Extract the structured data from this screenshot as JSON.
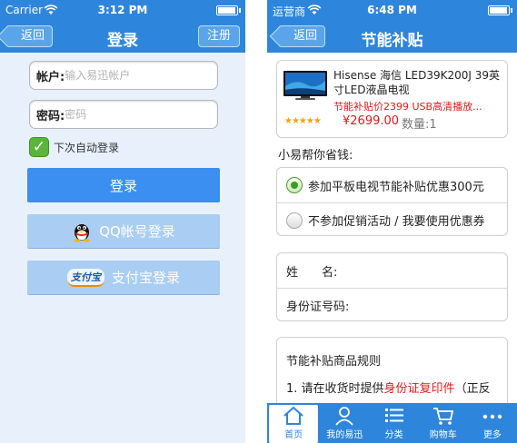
{
  "left": {
    "status": {
      "carrier": "Carrier",
      "time": "3:12 PM",
      "battery_fraction": 0.9
    },
    "nav": {
      "back": "返回",
      "title": "登录",
      "register": "注册"
    },
    "account": {
      "label": "帐户:",
      "placeholder": "输入易迅帐户"
    },
    "password": {
      "label": "密码:",
      "placeholder": "密码"
    },
    "remember": {
      "label": "下次自动登录",
      "checked": true
    },
    "buttons": {
      "login": "登录",
      "qq": "QQ帐号登录",
      "alipay": "支付宝登录",
      "alipay_logo": "支付宝"
    }
  },
  "right": {
    "status": {
      "carrier": "运营商",
      "time": "6:48 PM",
      "battery_fraction": 0.9
    },
    "nav": {
      "back": "返回",
      "title": "节能补贴"
    },
    "product": {
      "title": "Hisense 海信 LED39K200J 39英寸LED液晶电视",
      "promo": "节能补贴价2399 USB高清播放...",
      "rating_stars": 5,
      "price": "¥2699.00",
      "quantity": "数量:1"
    },
    "saving_label": "小易帮你省钱:",
    "options": [
      {
        "label": "参加平板电视节能补贴优惠300元",
        "selected": true
      },
      {
        "label": "不参加促销活动 / 我要使用优惠券",
        "selected": false
      }
    ],
    "form": {
      "name_label": "姓　　名:",
      "id_label": "身份证号码:"
    },
    "rules": {
      "title": "节能补贴商品规则",
      "line_pre": "1. 请在收货时提供",
      "line_highlight": "身份证复印件",
      "line_post": "（正反"
    },
    "tabs": [
      {
        "label": "首页",
        "icon": "home-icon",
        "active": true
      },
      {
        "label": "我的易迅",
        "icon": "user-icon",
        "active": false
      },
      {
        "label": "分类",
        "icon": "list-icon",
        "active": false
      },
      {
        "label": "购物车",
        "icon": "cart-icon",
        "active": false
      },
      {
        "label": "更多",
        "icon": "more-icon",
        "active": false
      }
    ]
  },
  "colors": {
    "nav_blue": "#2e86dc",
    "price_red": "#e0181a",
    "check_green": "#5bb53b"
  }
}
